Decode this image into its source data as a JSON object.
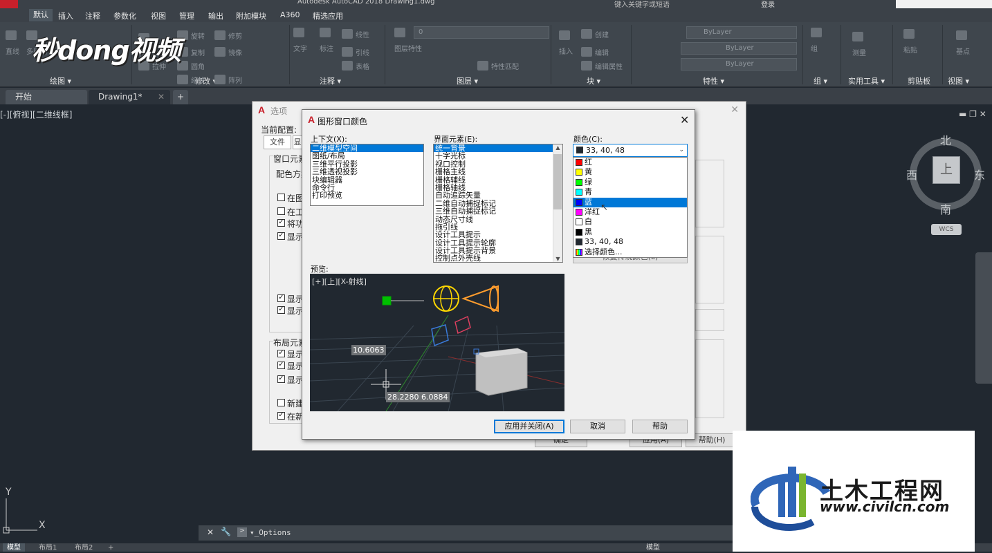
{
  "window": {
    "title": "Autodesk AutoCAD 2018    Drawing1.dwg",
    "search_hint": "键入关键字或短语",
    "login": "登录"
  },
  "menu_tabs": [
    "默认",
    "插入",
    "注释",
    "参数化",
    "视图",
    "管理",
    "输出",
    "附加模块",
    "A360",
    "精选应用"
  ],
  "ribbon": {
    "groups": [
      "绘图 ▾",
      "修改 ▾",
      "注释 ▾",
      "图层 ▾",
      "块 ▾",
      "特性 ▾",
      "组 ▾",
      "实用工具 ▾",
      "剪贴板",
      "视图 ▾"
    ],
    "labels": [
      "直线",
      "多段线",
      "移动",
      "旋转",
      "修剪",
      "复制",
      "镜像",
      "圆角",
      "拉伸",
      "缩放",
      "阵列",
      "文字",
      "标注",
      "线性",
      "引线",
      "表格",
      "图层特性",
      "插入",
      "创建",
      "编辑",
      "编辑属性",
      "特性匹配",
      "组",
      "测量",
      "粘贴",
      "基点"
    ],
    "layer_value": "0",
    "bylayer1": "ByLayer",
    "bylayer2": "ByLayer",
    "bylayer3": "ByLayer"
  },
  "watermark": {
    "text": "秒dong视频"
  },
  "doc_tabs": {
    "start": "开始",
    "drawing": "Drawing1*",
    "add": "+"
  },
  "viewport_label": "[-][俯视][二维线框]",
  "viewcube": {
    "north": "北",
    "south": "南",
    "east": "东",
    "west": "西",
    "top": "上",
    "wcs": "WCS"
  },
  "options_dialog": {
    "title": "选项",
    "current_profile_label": "当前配置:",
    "tabs": [
      "文件",
      "显"
    ],
    "window_elements_label": "窗口元素",
    "color_scheme_label": "配色方案",
    "checks": [
      "在图",
      "在工",
      "将功",
      "显示"
    ],
    "checks_state": [
      false,
      false,
      true,
      true
    ],
    "layout_label": "布局元素",
    "layout_checks": [
      "显示",
      "显示",
      "显示",
      "新建",
      "在新"
    ],
    "layout_checks_state": [
      true,
      true,
      true,
      false,
      true
    ],
    "bottom_buttons": [
      "确定",
      "取消",
      "应用(A)",
      "帮助(H)"
    ]
  },
  "color_dialog": {
    "title": "图形窗口颜色",
    "context_label": "上下文(X):",
    "contexts": [
      "二维模型空间",
      "图纸/布局",
      "三维平行投影",
      "三维透视投影",
      "块编辑器",
      "命令行",
      "打印预览"
    ],
    "interface_label": "界面元素(E):",
    "elements": [
      "统一背景",
      "十字光标",
      "视口控制",
      "栅格主线",
      "栅格辅线",
      "栅格轴线",
      "自动追踪矢量",
      "二维自动捕捉标记",
      "三维自动捕捉标记",
      "动态尺寸线",
      "拖引线",
      "设计工具提示",
      "设计工具提示轮廓",
      "设计工具提示背景",
      "控制点外壳线"
    ],
    "color_label": "颜色(C):",
    "current_color": "33, 40, 48",
    "color_options": [
      {
        "name": "红",
        "hex": "#ff0000"
      },
      {
        "name": "黄",
        "hex": "#ffff00"
      },
      {
        "name": "绿",
        "hex": "#00ff00"
      },
      {
        "name": "青",
        "hex": "#00ffff"
      },
      {
        "name": "蓝",
        "hex": "#0000ff"
      },
      {
        "name": "洋红",
        "hex": "#ff00ff"
      },
      {
        "name": "白",
        "hex": "#ffffff"
      },
      {
        "name": "黑",
        "hex": "#000000"
      },
      {
        "name": "33, 40, 48",
        "hex": "#212830"
      },
      {
        "name": "选择颜色...",
        "hex": "multi"
      }
    ],
    "selected_color_index": 4,
    "restore_button": "恢复传统颜色(L)",
    "preview_label": "预览:",
    "preview": {
      "viewport_label": "[+][上][X-射线]",
      "dim1": "10.6063",
      "dim2": "28.2280",
      "dim3": "6.0884"
    },
    "buttons": {
      "apply_close": "应用并关闭(A)",
      "cancel": "取消",
      "help": "帮助"
    }
  },
  "command_line": {
    "text": "_Options"
  },
  "status_tabs": [
    "模型",
    "布局1",
    "布局2"
  ],
  "status_right": "模型",
  "ucs": {
    "x": "X",
    "y": "Y"
  },
  "brand": {
    "name": "土木工程网",
    "url": "www.civilcn.com"
  }
}
